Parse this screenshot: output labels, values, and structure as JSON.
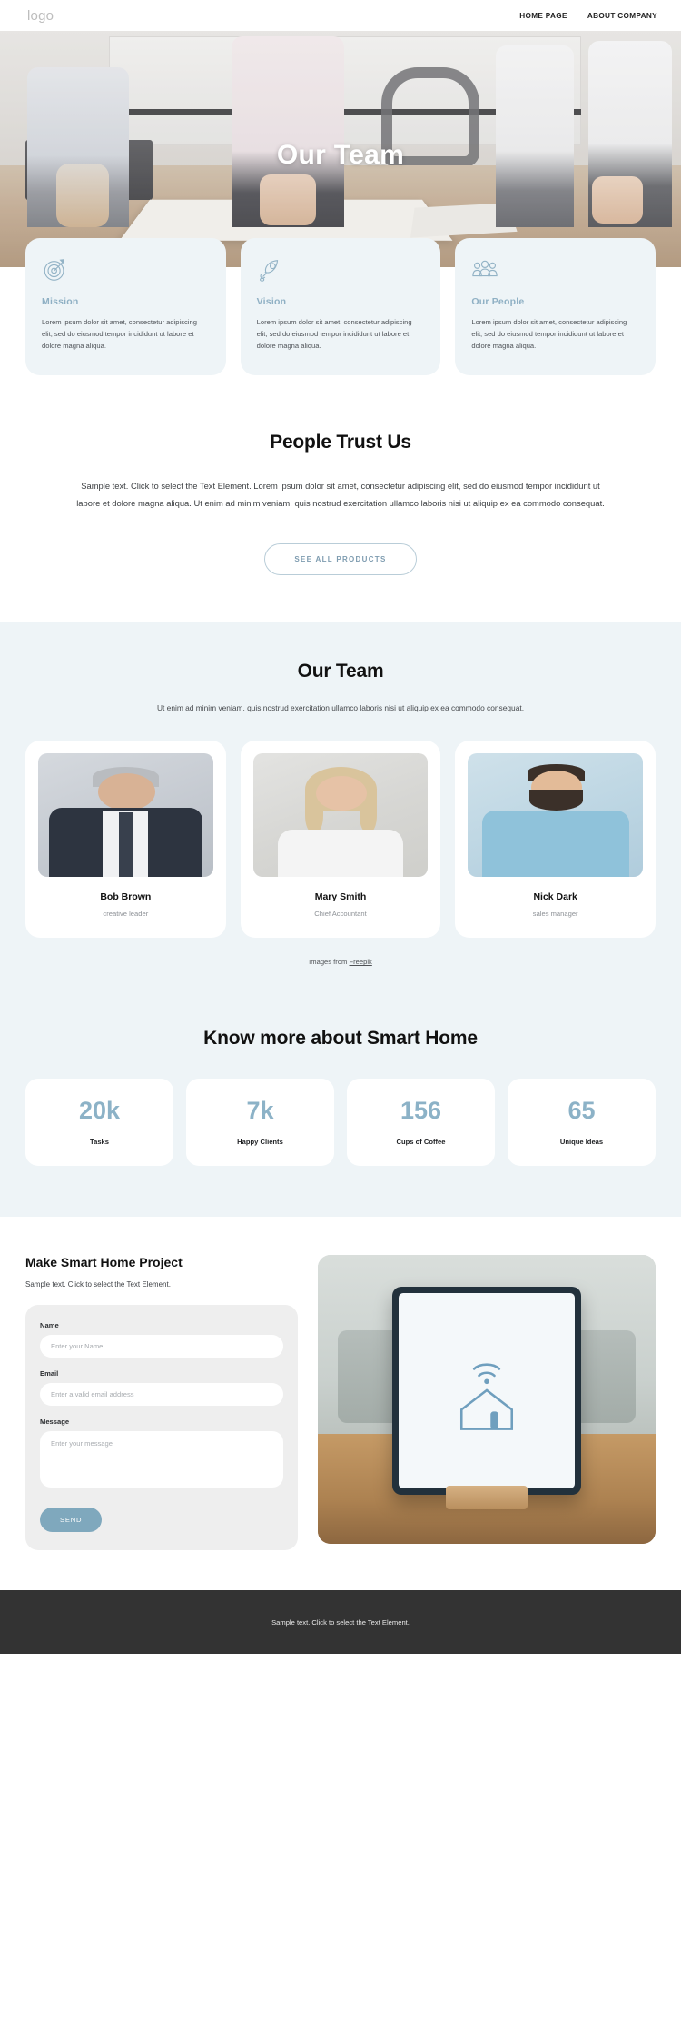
{
  "header": {
    "logo": "logo",
    "nav": [
      {
        "label": "HOME PAGE"
      },
      {
        "label": "ABOUT COMPANY"
      }
    ]
  },
  "hero": {
    "title": "Our Team"
  },
  "features": [
    {
      "icon": "target-icon",
      "title": "Mission",
      "text": "Lorem ipsum dolor sit amet, consectetur adipiscing elit, sed do eiusmod tempor incididunt ut labore et dolore magna aliqua."
    },
    {
      "icon": "rocket-icon",
      "title": "Vision",
      "text": "Lorem ipsum dolor sit amet, consectetur adipiscing elit, sed do eiusmod tempor incididunt ut labore et dolore magna aliqua."
    },
    {
      "icon": "people-group-icon",
      "title": "Our People",
      "text": "Lorem ipsum dolor sit amet, consectetur adipiscing elit, sed do eiusmod tempor incididunt ut labore et dolore magna aliqua."
    }
  ],
  "trust": {
    "title": "People Trust Us",
    "text": "Sample text. Click to select the Text Element. Lorem ipsum dolor sit amet, consectetur adipiscing elit, sed do eiusmod tempor incididunt ut labore et dolore magna aliqua. Ut enim ad minim veniam, quis nostrud exercitation ullamco laboris nisi ut aliquip ex ea commodo consequat.",
    "cta_label": "SEE ALL PRODUCTS"
  },
  "team": {
    "title": "Our Team",
    "subtitle": "Ut enim ad minim veniam, quis nostrud exercitation ullamco laboris nisi ut aliquip ex ea commodo consequat.",
    "members": [
      {
        "name": "Bob Brown",
        "role": "creative leader"
      },
      {
        "name": "Mary Smith",
        "role": "Chief Accountant"
      },
      {
        "name": "Nick Dark",
        "role": "sales manager"
      }
    ],
    "credit_prefix": "Images from ",
    "credit_link": "Freepik"
  },
  "stats": {
    "title": "Know more about Smart Home",
    "items": [
      {
        "value": "20k",
        "label": "Tasks"
      },
      {
        "value": "7k",
        "label": "Happy Clients"
      },
      {
        "value": "156",
        "label": "Cups of Coffee"
      },
      {
        "value": "65",
        "label": "Unique Ideas"
      }
    ]
  },
  "contact": {
    "title": "Make Smart Home Project",
    "subtitle": "Sample text. Click to select the Text Element.",
    "name_label": "Name",
    "name_placeholder": "Enter your Name",
    "name_value": "",
    "email_label": "Email",
    "email_placeholder": "Enter a valid email address",
    "email_value": "",
    "message_label": "Message",
    "message_placeholder": "Enter your message",
    "message_value": "",
    "send_label": "SEND"
  },
  "footer": {
    "text": "Sample text. Click to select the Text Element."
  },
  "colors": {
    "accent": "#8cb2c7",
    "section_bg": "#eef4f7",
    "card_bg": "#ffffff",
    "footer_bg": "#333333",
    "feature_title": "#8fb0c4"
  }
}
